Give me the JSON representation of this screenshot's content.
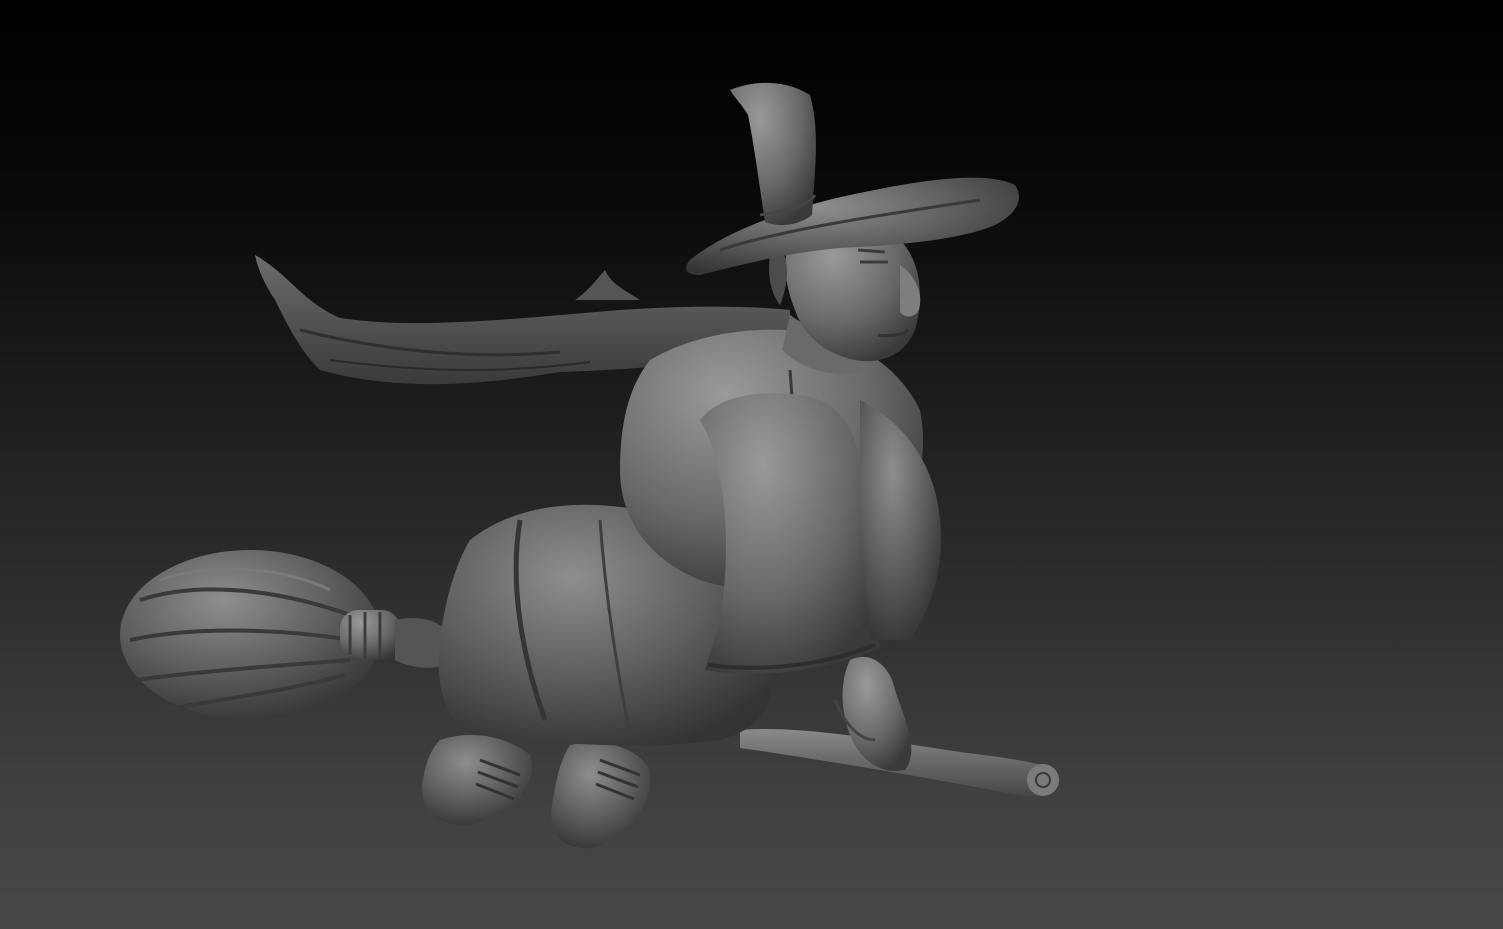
{
  "scene": {
    "subject": "witch-on-broomstick-sculpt",
    "colors": {
      "background_top": "#000000",
      "background_bottom": "#474747",
      "clay_base": "#5a5a5a",
      "clay_highlight": "#8e8e8e",
      "clay_shadow": "#2e2e2e"
    }
  }
}
